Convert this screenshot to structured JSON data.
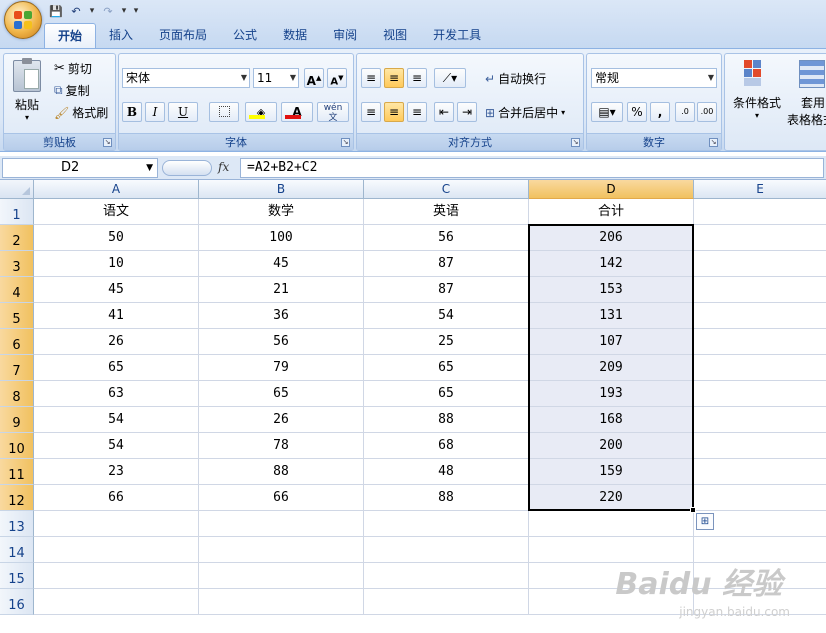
{
  "quick_access": {
    "save": "💾",
    "undo": "↶",
    "redo": "↷",
    "more": "▾"
  },
  "tabs": [
    {
      "label": "开始",
      "active": true
    },
    {
      "label": "插入"
    },
    {
      "label": "页面布局"
    },
    {
      "label": "公式"
    },
    {
      "label": "数据"
    },
    {
      "label": "审阅"
    },
    {
      "label": "视图"
    },
    {
      "label": "开发工具"
    }
  ],
  "ribbon": {
    "clipboard": {
      "label": "剪贴板",
      "paste": "粘贴",
      "cut": "剪切",
      "copy": "复制",
      "format_painter": "格式刷"
    },
    "font": {
      "label": "字体",
      "name": "宋体",
      "size": "11",
      "grow": "A",
      "shrink": "A",
      "bold": "B",
      "italic": "I",
      "underline": "U",
      "font_color": "A",
      "phonetic": "wén"
    },
    "alignment": {
      "label": "对齐方式",
      "wrap": "自动换行",
      "merge": "合并后居中"
    },
    "number": {
      "label": "数字",
      "format": "常规",
      "percent": "%",
      "comma": ",",
      "inc_decimal": ".0",
      "dec_decimal": ".00"
    },
    "styles": {
      "conditional": "条件格式",
      "table_line1": "套用",
      "table_line2": "表格格式"
    }
  },
  "formula_bar": {
    "name_box": "D2",
    "fx": "fx",
    "formula": "=A2+B2+C2"
  },
  "columns": [
    {
      "letter": "A",
      "selected": false
    },
    {
      "letter": "B",
      "selected": false
    },
    {
      "letter": "C",
      "selected": false
    },
    {
      "letter": "D",
      "selected": true
    },
    {
      "letter": "E",
      "selected": false
    }
  ],
  "rows": [
    {
      "n": "1",
      "cells": [
        "语文",
        "数学",
        "英语",
        "合计",
        ""
      ]
    },
    {
      "n": "2",
      "cells": [
        "50",
        "100",
        "56",
        "206",
        ""
      ]
    },
    {
      "n": "3",
      "cells": [
        "10",
        "45",
        "87",
        "142",
        ""
      ]
    },
    {
      "n": "4",
      "cells": [
        "45",
        "21",
        "87",
        "153",
        ""
      ]
    },
    {
      "n": "5",
      "cells": [
        "41",
        "36",
        "54",
        "131",
        ""
      ]
    },
    {
      "n": "6",
      "cells": [
        "26",
        "56",
        "25",
        "107",
        ""
      ]
    },
    {
      "n": "7",
      "cells": [
        "65",
        "79",
        "65",
        "209",
        ""
      ]
    },
    {
      "n": "8",
      "cells": [
        "63",
        "65",
        "65",
        "193",
        ""
      ]
    },
    {
      "n": "9",
      "cells": [
        "54",
        "26",
        "88",
        "168",
        ""
      ]
    },
    {
      "n": "10",
      "cells": [
        "54",
        "78",
        "68",
        "200",
        ""
      ]
    },
    {
      "n": "11",
      "cells": [
        "23",
        "88",
        "48",
        "159",
        ""
      ]
    },
    {
      "n": "12",
      "cells": [
        "66",
        "66",
        "88",
        "220",
        ""
      ]
    },
    {
      "n": "13",
      "cells": [
        "",
        "",
        "",
        "",
        ""
      ]
    },
    {
      "n": "14",
      "cells": [
        "",
        "",
        "",
        "",
        ""
      ]
    },
    {
      "n": "15",
      "cells": [
        "",
        "",
        "",
        "",
        ""
      ]
    },
    {
      "n": "16",
      "cells": [
        "",
        "",
        "",
        "",
        ""
      ]
    }
  ],
  "selection": {
    "col": 3,
    "row_start": 2,
    "row_end": 12
  },
  "watermark": {
    "main": "Baidu 经验",
    "sub": "jingyan.baidu.com"
  },
  "colors": {
    "selection_fill": "#e8ebf5",
    "header_selected": "#f1c15f",
    "ribbon_blue": "#15428b"
  }
}
